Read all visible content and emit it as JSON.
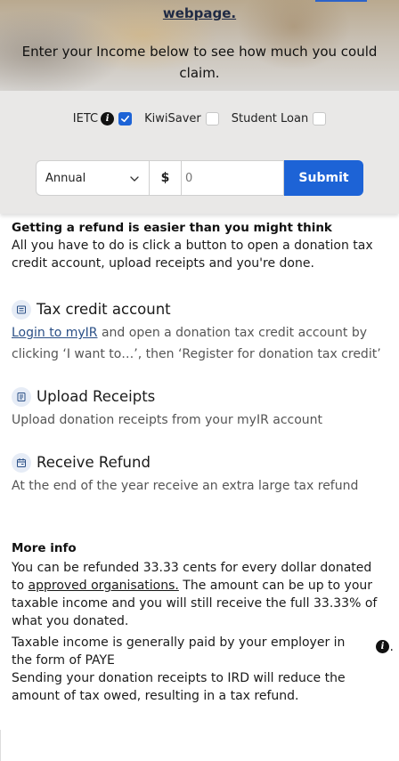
{
  "hero": {
    "link_text": "webpage.",
    "intro": "Enter your Income below to see how much you could claim."
  },
  "options": {
    "ietc_label": "IETC",
    "ietc_checked": true,
    "kiwisaver_label": "KiwiSaver",
    "kiwisaver_checked": false,
    "student_loan_label": "Student Loan",
    "student_loan_checked": false,
    "info_glyph": "i"
  },
  "form": {
    "period_selected": "Annual",
    "currency_symbol": "$",
    "amount_placeholder": "0",
    "submit_label": "Submit"
  },
  "intro_section": {
    "heading": "Getting a refund is easier than you might think",
    "body": "All you have to do is click a button to open a donation tax credit account, upload receipts and you're done."
  },
  "steps": [
    {
      "icon": "account-icon",
      "title": "Tax credit account",
      "link": "Login to myIR",
      "text": " and open a donation tax credit account by clicking ‘I want to…’, then ‘Register for donation tax credit’"
    },
    {
      "icon": "receipt-icon",
      "title": "Upload Receipts",
      "text": "Upload donation receipts from your myIR account"
    },
    {
      "icon": "calendar-icon",
      "title": "Receive Refund",
      "text": "At the end of the year receive an extra large tax refund"
    }
  ],
  "more_info": {
    "heading": "More info",
    "para1_before": "You can be refunded 33.33 cents for every dollar donated to ",
    "para1_link": "approved organisations.",
    "para1_after": " The amount can be up to your taxable income and you will still receive the full 33.33% of what you donated.",
    "para2": "Taxable income is generally paid by your employer in the form of PAYE",
    "para2_dot": ".",
    "para3": "Sending your donation receipts to IRD will reduce the amount of tax owed, resulting in a tax refund."
  },
  "colors": {
    "accent": "#1d63d6",
    "panel_bg": "#e9e8e7",
    "link": "#2a4f86"
  }
}
